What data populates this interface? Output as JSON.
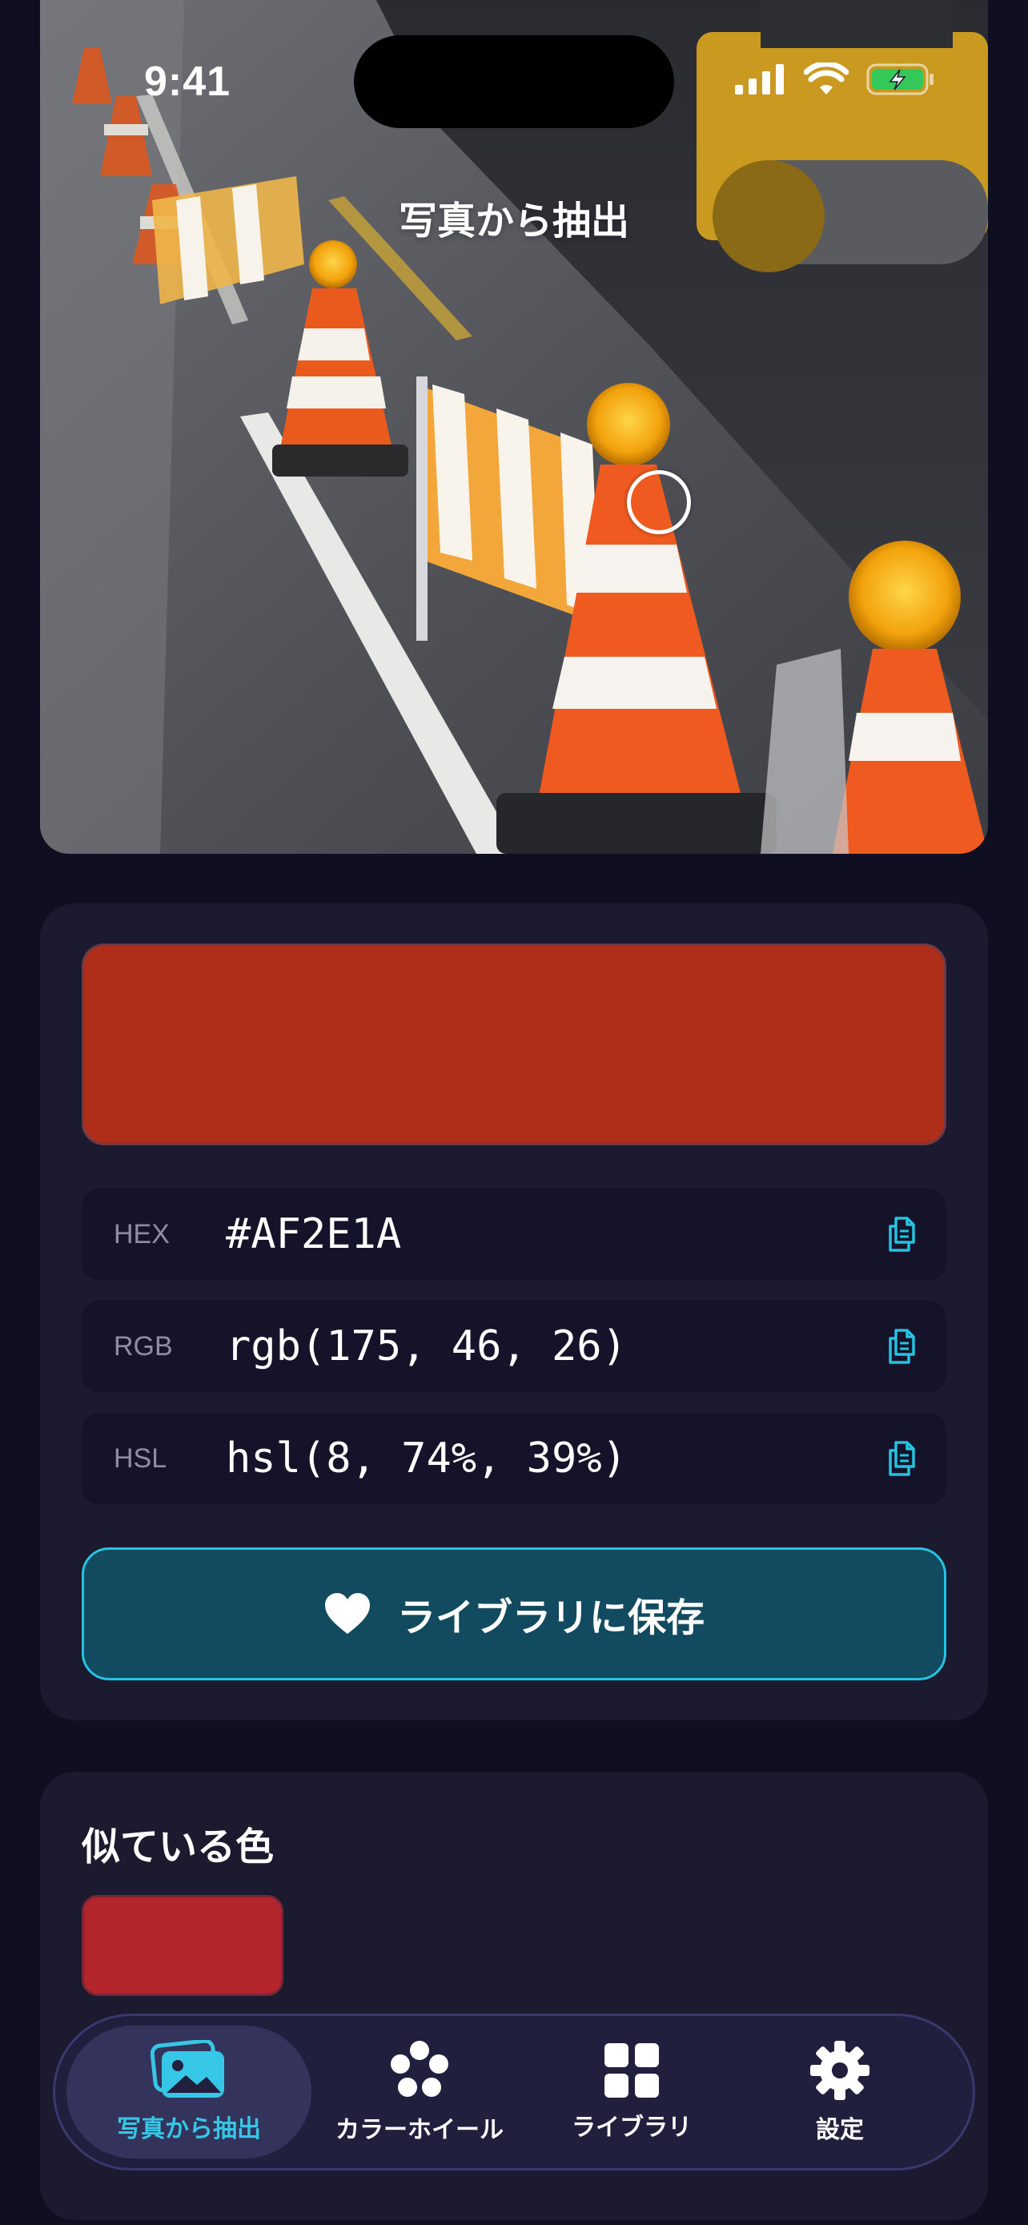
{
  "status_bar": {
    "time": "9:41"
  },
  "screen": {
    "title": "写真から抽出"
  },
  "picked_color": {
    "swatch_color": "#AF2E1A",
    "rows": [
      {
        "label": "HEX",
        "value": "#AF2E1A"
      },
      {
        "label": "RGB",
        "value": "rgb(175, 46, 26)"
      },
      {
        "label": "HSL",
        "value": "hsl(8, 74%, 39%)"
      }
    ]
  },
  "save_button": {
    "label": "ライブラリに保存",
    "icon": "heart-icon"
  },
  "similar_colors": {
    "title": "似ている色",
    "swatches": [
      {
        "color": "#B3272C"
      }
    ]
  },
  "tabbar": {
    "items": [
      {
        "label": "写真から抽出",
        "icon": "photo-icon",
        "active": true
      },
      {
        "label": "カラーホイール",
        "icon": "color-wheel-icon",
        "active": false
      },
      {
        "label": "ライブラリ",
        "icon": "grid-icon",
        "active": false
      },
      {
        "label": "設定",
        "icon": "gear-icon",
        "active": false
      }
    ]
  },
  "colors": {
    "accent": "#24C3E0",
    "background": "#100F22",
    "card": "#1B1A2E"
  }
}
